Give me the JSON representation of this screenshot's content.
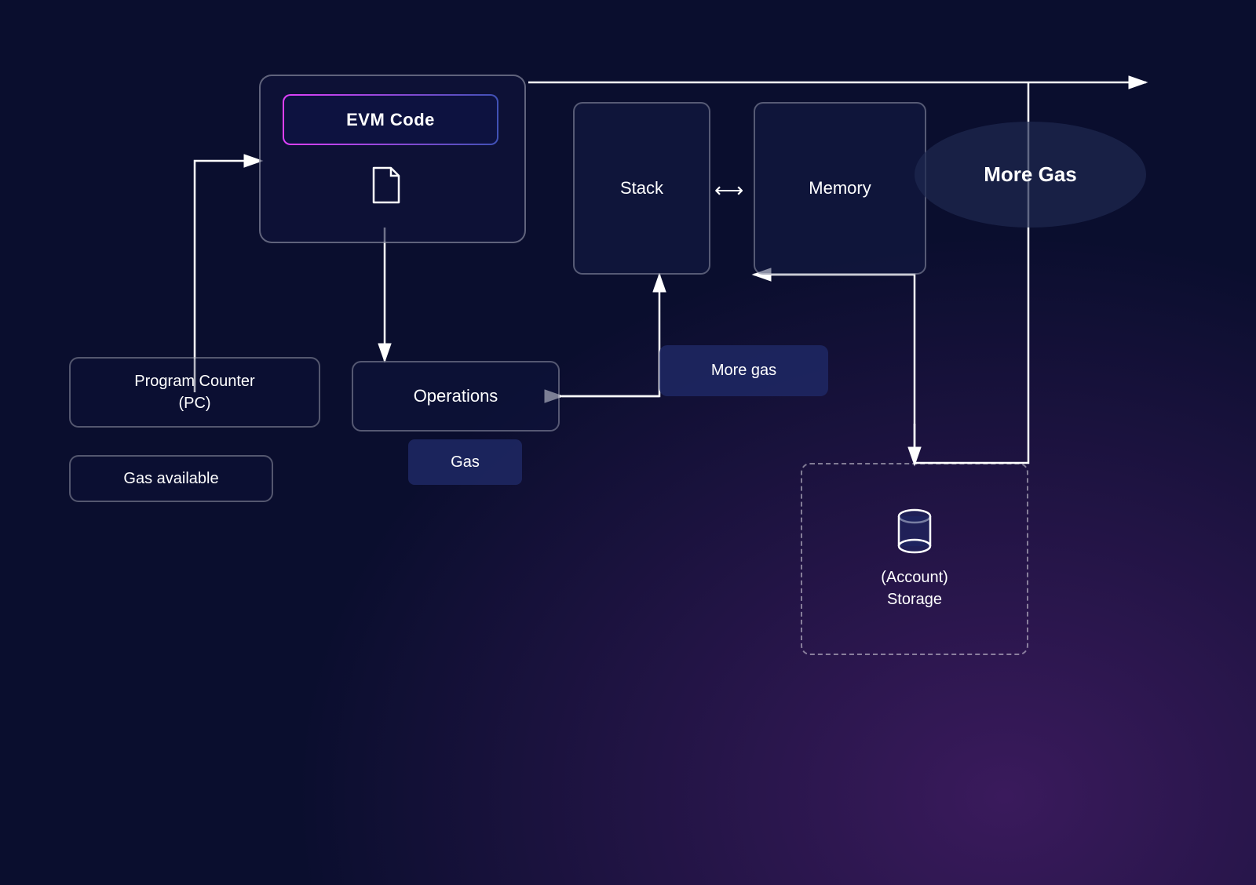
{
  "diagram": {
    "background": "#0a0e2e",
    "evm_code": {
      "label": "EVM Code"
    },
    "operations": {
      "label": "Operations"
    },
    "gas": {
      "label": "Gas"
    },
    "program_counter": {
      "label": "Program Counter\n(PC)"
    },
    "gas_available": {
      "label": "Gas available"
    },
    "stack": {
      "label": "Stack"
    },
    "memory": {
      "label": "Memory"
    },
    "more_gas_small": {
      "label": "More gas"
    },
    "more_gas_large": {
      "label": "More Gas"
    },
    "account_storage": {
      "label": "(Account)\nStorage"
    },
    "double_arrow": "⟷"
  }
}
